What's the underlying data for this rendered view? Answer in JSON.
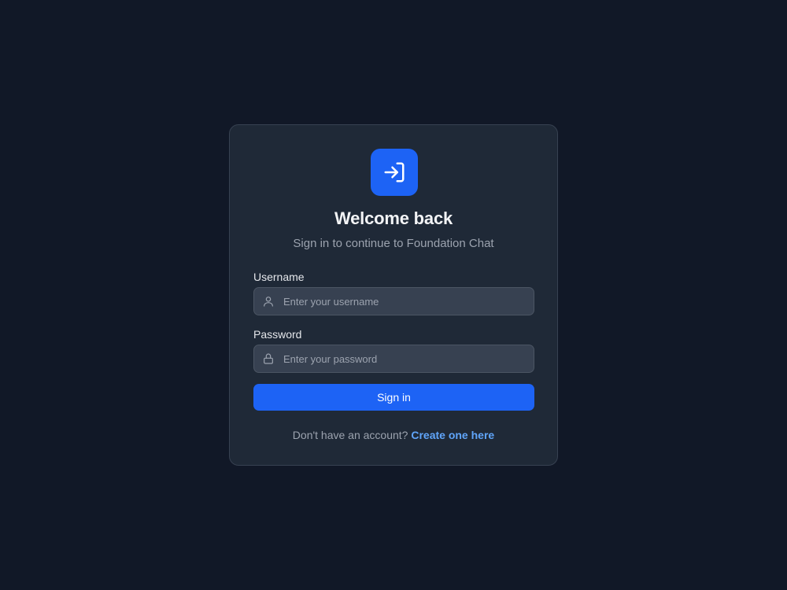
{
  "login": {
    "logo_icon": "sign-in-icon",
    "title": "Welcome back",
    "subtitle": "Sign in to continue to Foundation Chat",
    "username": {
      "label": "Username",
      "placeholder": "Enter your username",
      "icon": "user-icon"
    },
    "password": {
      "label": "Password",
      "placeholder": "Enter your password",
      "icon": "lock-icon"
    },
    "submit_label": "Sign in",
    "footer_text": "Don't have an account?",
    "footer_link": "Create one here"
  },
  "colors": {
    "background": "#111827",
    "card": "#1f2937",
    "accent": "#1d63f5",
    "link": "#60a5fa"
  }
}
